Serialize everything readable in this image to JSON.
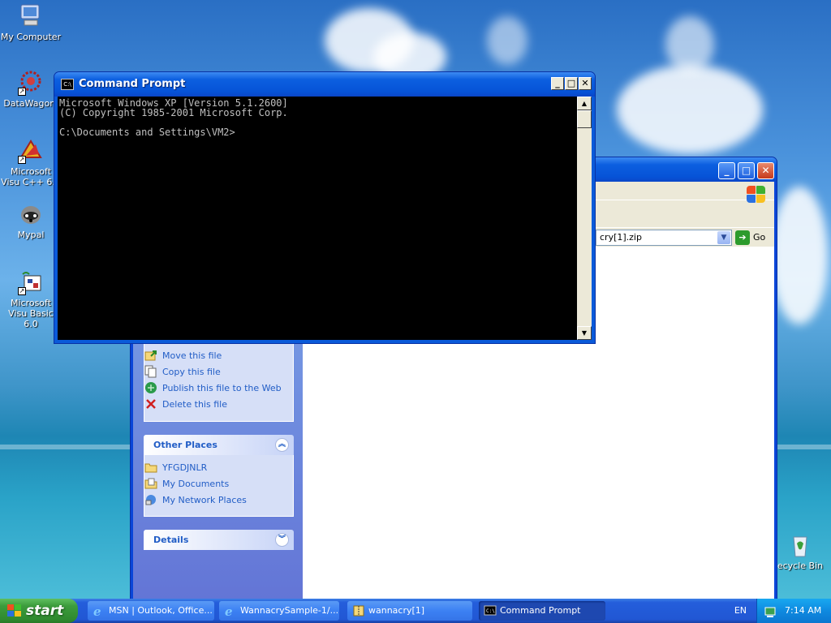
{
  "desktop": {
    "icons": [
      {
        "label": "My Computer"
      },
      {
        "label": "DataWagon."
      },
      {
        "label": "Microsoft Visu C++ 6.0"
      },
      {
        "label": "Mypal"
      },
      {
        "label": "Microsoft Visu Basic 6.0"
      },
      {
        "label": "ecycle Bin"
      }
    ]
  },
  "cmd": {
    "title": "Command Prompt",
    "icon_text": "C:\\",
    "lines": [
      "Microsoft Windows XP [Version 5.1.2600]",
      "(C) Copyright 1985-2001 Microsoft Corp.",
      "",
      "C:\\Documents and Settings\\VM2>"
    ],
    "min_glyph": "_",
    "max_glyph": "□",
    "close_glyph": "✕"
  },
  "explorer": {
    "address_value": "cry[1].zip",
    "go_label": "Go",
    "file_tasks": [
      {
        "label": "Move this file",
        "icon": "move-icon"
      },
      {
        "label": "Copy this file",
        "icon": "copy-icon"
      },
      {
        "label": "Publish this file to the Web",
        "icon": "publish-icon"
      },
      {
        "label": "Delete this file",
        "icon": "delete-icon"
      }
    ],
    "other_places_title": "Other Places",
    "other_places": [
      {
        "label": "YFGDJNLR",
        "icon": "folder-icon"
      },
      {
        "label": "My Documents",
        "icon": "my-documents-icon"
      },
      {
        "label": "My Network Places",
        "icon": "network-icon"
      }
    ],
    "details_title": "Details"
  },
  "taskbar": {
    "start_label": "start",
    "buttons": [
      {
        "label": "MSN | Outlook, Office...",
        "icon": "ie-icon"
      },
      {
        "label": "WannacrySample-1/...",
        "icon": "ie-icon"
      },
      {
        "label": "wannacry[1]",
        "icon": "zip-folder-icon"
      },
      {
        "label": "Command Prompt",
        "icon": "cmd-icon"
      }
    ],
    "language": "EN",
    "clock": "7:14 AM"
  }
}
